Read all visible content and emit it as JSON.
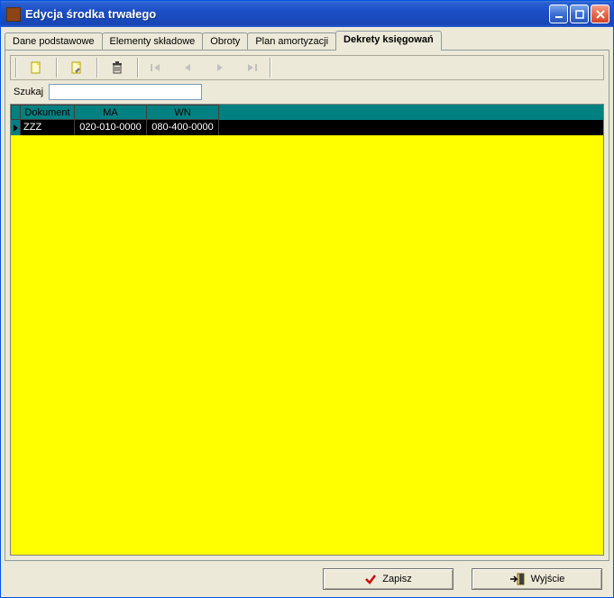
{
  "window": {
    "title": "Edycja środka trwałego"
  },
  "tabs": [
    {
      "label": "Dane podstawowe",
      "active": false
    },
    {
      "label": "Elementy składowe",
      "active": false
    },
    {
      "label": "Obroty",
      "active": false
    },
    {
      "label": "Plan amortyzacji",
      "active": false
    },
    {
      "label": "Dekrety księgowań",
      "active": true
    }
  ],
  "search": {
    "label": "Szukaj",
    "value": ""
  },
  "grid": {
    "columns": [
      "Dokument",
      "MA",
      "WN"
    ],
    "rows": [
      {
        "dokument": "ZZZ",
        "ma": "020-010-0000",
        "wn": "080-400-0000"
      }
    ]
  },
  "buttons": {
    "save": "Zapisz",
    "exit": "Wyjście"
  }
}
